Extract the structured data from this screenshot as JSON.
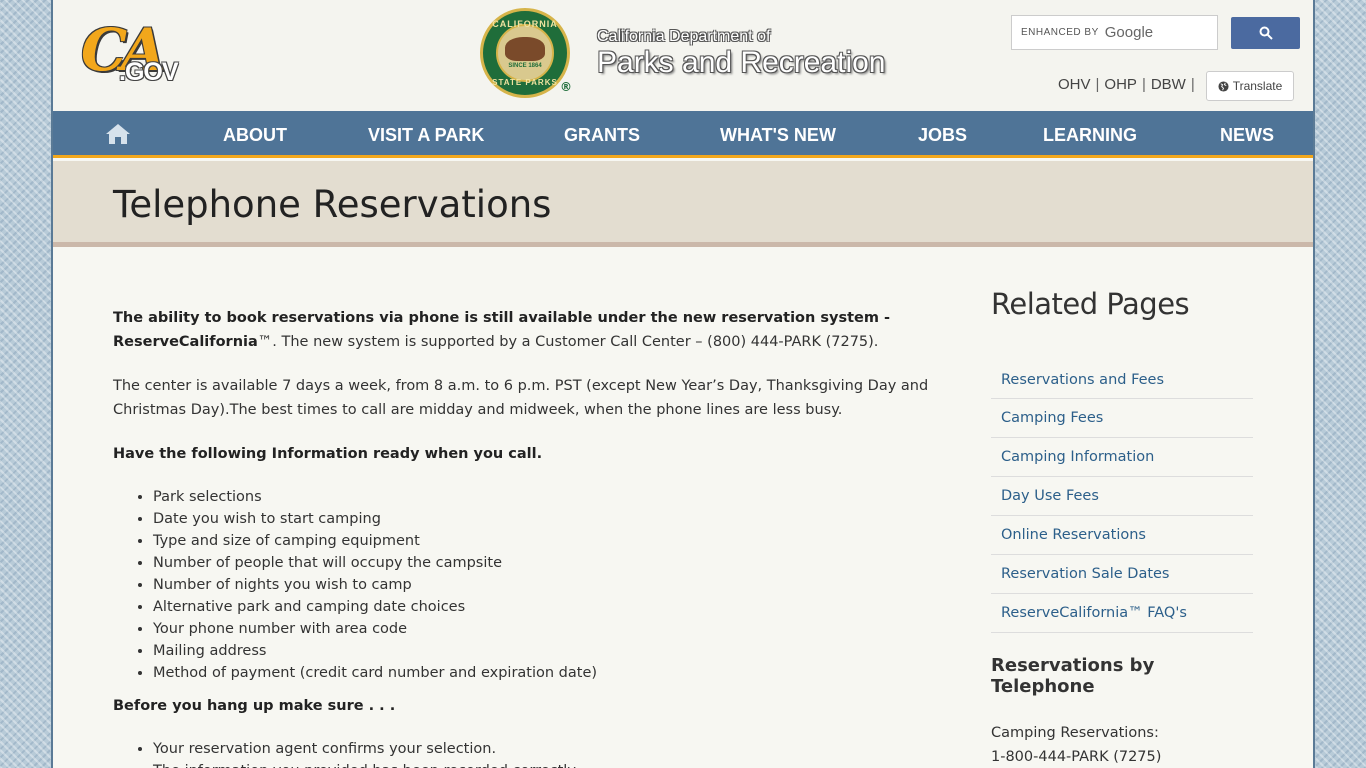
{
  "header": {
    "ca_logo": {
      "ca": "CA",
      "gov": ".GOV"
    },
    "seal": {
      "top": "CALIFORNIA",
      "bottom": "STATE PARKS",
      "since": "SINCE 1864",
      "reg": "®"
    },
    "dept_small": "California Department of",
    "dept_big": "Parks and Recreation",
    "search": {
      "enhanced_by": "ENHANCED BY",
      "google": "Google"
    },
    "top_links": [
      "OHV",
      "OHP",
      "DBW"
    ],
    "separator": "|",
    "translate_label": "Translate"
  },
  "nav": {
    "items": [
      "ABOUT",
      "VISIT A PARK",
      "GRANTS",
      "WHAT'S NEW",
      "JOBS",
      "LEARNING",
      "NEWS"
    ]
  },
  "title": "Telephone Reservations",
  "content": {
    "p1_bold": "The ability to book reservations via phone is still available under the new reservation system - ReserveCalifornia",
    "p1_rest": "™. The new system is supported by a Customer Call Center – (800) 444-PARK (7275).",
    "p2": "The center is available 7 days a week, from 8 a.m. to 6 p.m. PST (except New Year’s Day, Thanksgiving Day and Christmas Day).The best times to call are midday and midweek, when the phone lines are less busy.",
    "h1": "Have the following Information ready when you call.",
    "list1": [
      "Park selections",
      "Date you wish to start camping",
      "Type and size of camping equipment",
      "Number of people that will occupy the campsite",
      "Number of nights you wish to camp",
      "Alternative park and camping date choices",
      "Your phone number with area code",
      "Mailing address",
      "Method of payment (credit card number and expiration date)"
    ],
    "h2": "Before you hang up make sure . . .",
    "list2": [
      "Your reservation agent confirms your selection.",
      "The information you provided has been recorded correctly."
    ]
  },
  "sidebar": {
    "title": "Related Pages",
    "links": [
      "Reservations and Fees",
      "Camping Fees",
      "Camping Information",
      "Day Use Fees",
      "Online Reservations",
      "Reservation Sale Dates",
      "ReserveCalifornia™ FAQ's"
    ],
    "sub_title": "Reservations by Telephone",
    "camping_label": "Camping Reservations:",
    "camping_phone": "1-800-444-PARK (7275)"
  },
  "colors": {
    "nav_bg": "#4f7497",
    "accent": "#f2a71b",
    "link": "#2c5f8a",
    "search_btn": "#4b6aa0"
  }
}
